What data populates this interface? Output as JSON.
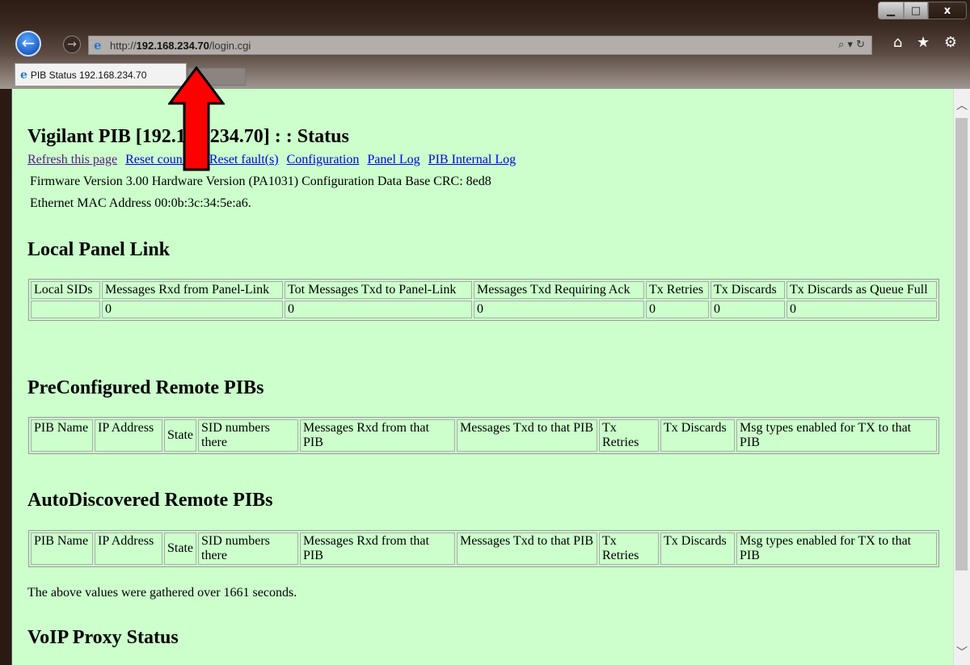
{
  "browser": {
    "url_prefix": "http://",
    "url_host": "192.168.234.70",
    "url_path": "/login.cgi",
    "tab_title": "PIB Status 192.168.234.70",
    "window_buttons": {
      "minimize": "▁",
      "maximize": "□",
      "close": "x"
    },
    "address_tools": "⌕ ▾ ↻",
    "tool_icons": "⌂ ★ ⚙"
  },
  "page": {
    "title": "Vigilant PIB [192.168.234.70] : : Status",
    "links": [
      "Refresh this page",
      "Reset counters",
      "Reset fault(s)",
      "Configuration",
      "Panel Log",
      "PIB Internal Log"
    ],
    "firmware_info": "Firmware Version 3.00 Hardware Version (PA1031) Configuration Data Base CRC: 8ed8",
    "mac_info": "Ethernet MAC Address 00:0b:3c:34:5e:a6.",
    "local_panel": {
      "heading": "Local Panel Link",
      "headers": [
        "Local SIDs",
        "Messages Rxd from Panel-Link",
        "Tot Messages Txd to Panel-Link",
        "Messages Txd Requiring Ack",
        "Tx Retries",
        "Tx Discards",
        "Tx Discards as Queue Full"
      ],
      "row": [
        "",
        "0",
        "0",
        "0",
        "0",
        "0",
        "0"
      ]
    },
    "preconfigured": {
      "heading": "PreConfigured Remote PIBs",
      "headers": [
        "PIB Name",
        "IP Address",
        "State",
        "SID numbers there",
        "Messages Rxd from that PIB",
        "Messages Txd to that PIB",
        "Tx Retries",
        "Tx Discards",
        "Msg types enabled for TX to that PIB"
      ]
    },
    "autodiscovered": {
      "heading": "AutoDiscovered Remote PIBs",
      "headers": [
        "PIB Name",
        "IP Address",
        "State",
        "SID numbers there",
        "Messages Rxd from that PIB",
        "Messages Txd to that PIB",
        "Tx Retries",
        "Tx Discards",
        "Msg types enabled for TX to that PIB"
      ]
    },
    "footnote": "The above values were gathered over 1661 seconds.",
    "voip_heading": "VoIP Proxy Status"
  },
  "colors": {
    "page_bg": "#ccffcc",
    "link": "#0000ee",
    "visited_link": "#551a8b",
    "annotation_arrow": "#ff0000"
  }
}
